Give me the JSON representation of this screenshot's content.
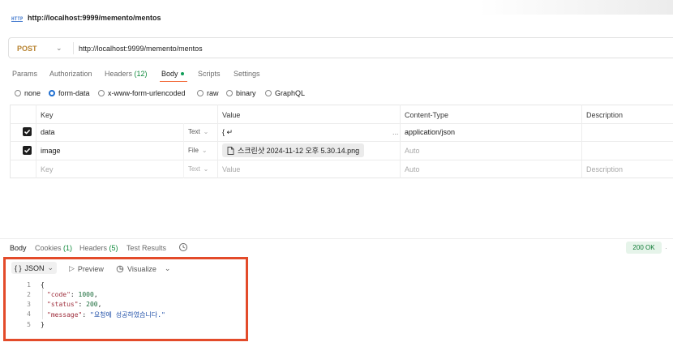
{
  "request": {
    "title": "http://localhost:9999/memento/mentos",
    "method": "POST",
    "url": "http://localhost:9999/memento/mentos"
  },
  "tabs": {
    "params": "Params",
    "authorization": "Authorization",
    "headers_label": "Headers",
    "headers_count": "(12)",
    "body": "Body",
    "scripts": "Scripts",
    "settings": "Settings"
  },
  "body_types": {
    "none": "none",
    "form_data": "form-data",
    "urlencoded": "x-www-form-urlencoded",
    "raw": "raw",
    "binary": "binary",
    "graphql": "GraphQL",
    "selected": "form-data"
  },
  "table": {
    "headers": {
      "key": "Key",
      "value": "Value",
      "content_type": "Content-Type",
      "description": "Description"
    },
    "rows": [
      {
        "checked": true,
        "key": "data",
        "type": "Text",
        "value": "{ ↵",
        "value_more": "...",
        "content_type": "application/json",
        "description": ""
      },
      {
        "checked": true,
        "key": "image",
        "type": "File",
        "value": "스크린샷 2024-11-12 오후 5.30.14.png",
        "content_type": "Auto",
        "description": ""
      }
    ],
    "placeholder_row": {
      "key": "Key",
      "type": "Text",
      "value": "Value",
      "content_type": "Auto",
      "description": "Description"
    }
  },
  "response": {
    "tabs": {
      "body": "Body",
      "cookies_label": "Cookies",
      "cookies_count": "(1)",
      "headers_label": "Headers",
      "headers_count": "(5)",
      "test_results": "Test Results"
    },
    "status": "200 OK",
    "format_icon": "{ }",
    "format": "JSON",
    "preview": "Preview",
    "visualize": "Visualize",
    "lines": [
      {
        "n": "1",
        "open": "{"
      },
      {
        "n": "2",
        "key": "\"code\"",
        "val": "1000",
        "kind": "num",
        "end": ","
      },
      {
        "n": "3",
        "key": "\"status\"",
        "val": "200",
        "kind": "num",
        "end": ","
      },
      {
        "n": "4",
        "key": "\"message\"",
        "val": "\"요청에 성공하였습니다.\"",
        "kind": "str",
        "end": ""
      },
      {
        "n": "5",
        "open": "}"
      }
    ]
  },
  "colors": {
    "accent": "#f26b3a",
    "method": "#b7822e",
    "success": "#0f7a35",
    "highlight_box": "#e34b2a"
  }
}
